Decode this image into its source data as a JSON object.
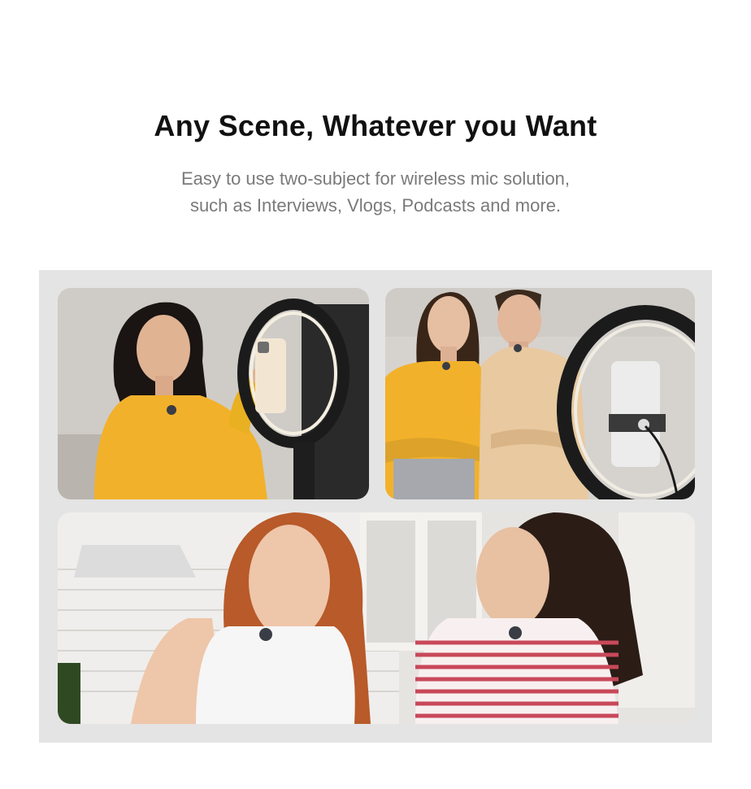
{
  "header": {
    "title": "Any Scene, Whatever you Want",
    "subtitle_line1": "Easy to use two-subject for wireless mic solution,",
    "subtitle_line2": "such as Interviews, Vlogs, Podcasts and more."
  },
  "colors": {
    "title": "#111111",
    "subtitle": "#7a7a7a",
    "panel_bg": "#e4e4e4",
    "shirt_yellow": "#f2b12a",
    "shirt_beige": "#e8c9a0",
    "ring_light": "#1b1b1b"
  },
  "gallery": {
    "photos": [
      {
        "scene": "vlog-ring-light"
      },
      {
        "scene": "interview-duo"
      },
      {
        "scene": "kitchen-podcast"
      }
    ]
  }
}
